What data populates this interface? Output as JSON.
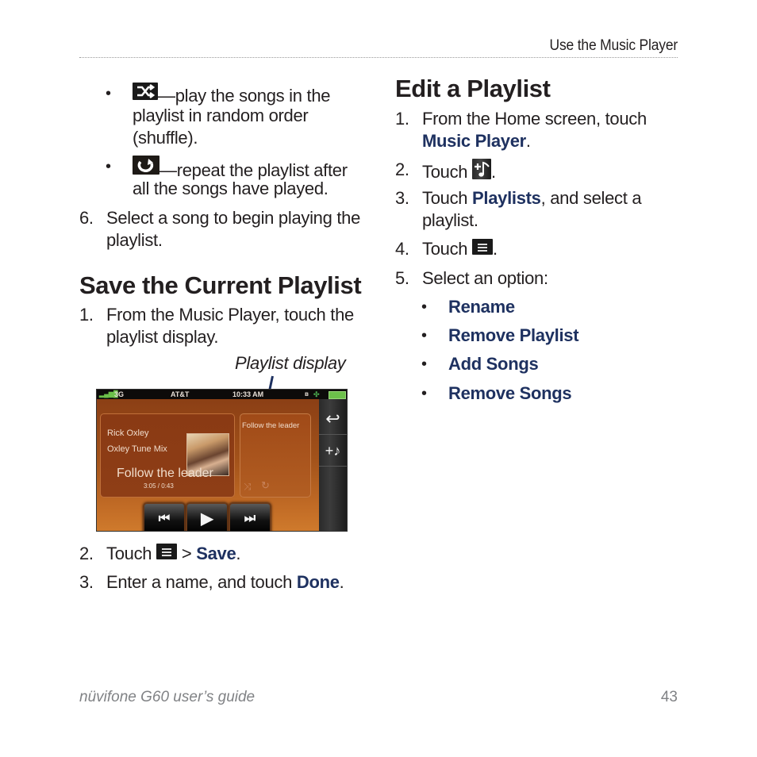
{
  "header": {
    "running_title": "Use the Music Player"
  },
  "left_column": {
    "bullets": [
      {
        "icon": "shuffle-icon",
        "text_line1": "—play the songs in the",
        "text_line2": "playlist in random order",
        "text_line3": "(shuffle)."
      },
      {
        "icon": "repeat-icon",
        "text_line1": "—repeat the playlist after",
        "text_line2": "all the songs have played."
      }
    ],
    "step6": {
      "number": "6.",
      "line1": "Select a song to begin playing the",
      "line2": "playlist."
    },
    "save_section": {
      "heading": "Save the Current Playlist",
      "step1": {
        "number": "1.",
        "line1": "From the Music Player, touch the",
        "line2": "playlist display."
      },
      "figure_caption": "Playlist display",
      "step2": {
        "number": "2.",
        "prefix": "Touch",
        "icon": "menu-icon",
        "separator": ">",
        "action": "Save",
        "suffix": "."
      },
      "step3": {
        "number": "3.",
        "prefix": "Enter a name, and touch",
        "action": "Done",
        "suffix": "."
      }
    }
  },
  "device_screen": {
    "status": {
      "network": "3G",
      "carrier": "AT&T",
      "time": "10:33 AM"
    },
    "now_playing": {
      "artist": "Rick Oxley",
      "album": "Oxley Tune Mix",
      "song": "Follow the leader",
      "time": "3:05 / 0:43"
    },
    "playlist_panel": {
      "current_song": "Follow the leader",
      "shuffle_glyph": "⤨",
      "repeat_glyph": "↻"
    },
    "rail_buttons": [
      {
        "name": "back",
        "glyph": "↩"
      },
      {
        "name": "add-song",
        "glyph": "+♪"
      }
    ],
    "controls": [
      {
        "name": "previous",
        "glyph": "⏮"
      },
      {
        "name": "play",
        "glyph": "▶"
      },
      {
        "name": "next",
        "glyph": "⏭"
      }
    ]
  },
  "right_column": {
    "heading": "Edit a Playlist",
    "steps": [
      {
        "number": "1.",
        "line1": "From the Home screen, touch",
        "action": "Music Player",
        "suffix": "."
      },
      {
        "number": "2.",
        "prefix": "Touch",
        "icon": "add-song-icon",
        "suffix": "."
      },
      {
        "number": "3.",
        "prefix": "Touch",
        "action": "Playlists",
        "rest": ", and select a",
        "line2": "playlist."
      },
      {
        "number": "4.",
        "prefix": "Touch",
        "icon": "menu-icon",
        "suffix": "."
      },
      {
        "number": "5.",
        "prefix": "Select an option:"
      }
    ],
    "options": [
      "Rename",
      "Remove Playlist",
      "Add Songs",
      "Remove Songs"
    ]
  },
  "footer": {
    "guide_title": "nüvifone G60 user’s guide",
    "page_number": "43"
  },
  "colors": {
    "link_blue": "#1e3160",
    "body_text": "#231f20",
    "footer_gray": "#808285"
  }
}
